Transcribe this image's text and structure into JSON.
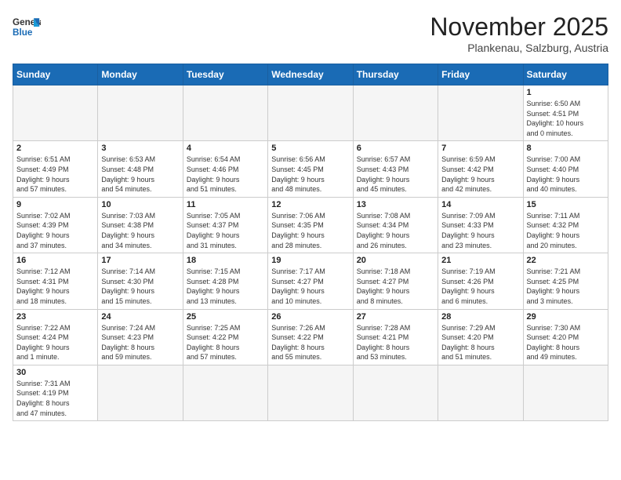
{
  "header": {
    "logo_line1": "General",
    "logo_line2": "Blue",
    "month": "November 2025",
    "location": "Plankenau, Salzburg, Austria"
  },
  "days_of_week": [
    "Sunday",
    "Monday",
    "Tuesday",
    "Wednesday",
    "Thursday",
    "Friday",
    "Saturday"
  ],
  "weeks": [
    [
      {
        "day": "",
        "info": ""
      },
      {
        "day": "",
        "info": ""
      },
      {
        "day": "",
        "info": ""
      },
      {
        "day": "",
        "info": ""
      },
      {
        "day": "",
        "info": ""
      },
      {
        "day": "",
        "info": ""
      },
      {
        "day": "1",
        "info": "Sunrise: 6:50 AM\nSunset: 4:51 PM\nDaylight: 10 hours\nand 0 minutes."
      }
    ],
    [
      {
        "day": "2",
        "info": "Sunrise: 6:51 AM\nSunset: 4:49 PM\nDaylight: 9 hours\nand 57 minutes."
      },
      {
        "day": "3",
        "info": "Sunrise: 6:53 AM\nSunset: 4:48 PM\nDaylight: 9 hours\nand 54 minutes."
      },
      {
        "day": "4",
        "info": "Sunrise: 6:54 AM\nSunset: 4:46 PM\nDaylight: 9 hours\nand 51 minutes."
      },
      {
        "day": "5",
        "info": "Sunrise: 6:56 AM\nSunset: 4:45 PM\nDaylight: 9 hours\nand 48 minutes."
      },
      {
        "day": "6",
        "info": "Sunrise: 6:57 AM\nSunset: 4:43 PM\nDaylight: 9 hours\nand 45 minutes."
      },
      {
        "day": "7",
        "info": "Sunrise: 6:59 AM\nSunset: 4:42 PM\nDaylight: 9 hours\nand 42 minutes."
      },
      {
        "day": "8",
        "info": "Sunrise: 7:00 AM\nSunset: 4:40 PM\nDaylight: 9 hours\nand 40 minutes."
      }
    ],
    [
      {
        "day": "9",
        "info": "Sunrise: 7:02 AM\nSunset: 4:39 PM\nDaylight: 9 hours\nand 37 minutes."
      },
      {
        "day": "10",
        "info": "Sunrise: 7:03 AM\nSunset: 4:38 PM\nDaylight: 9 hours\nand 34 minutes."
      },
      {
        "day": "11",
        "info": "Sunrise: 7:05 AM\nSunset: 4:37 PM\nDaylight: 9 hours\nand 31 minutes."
      },
      {
        "day": "12",
        "info": "Sunrise: 7:06 AM\nSunset: 4:35 PM\nDaylight: 9 hours\nand 28 minutes."
      },
      {
        "day": "13",
        "info": "Sunrise: 7:08 AM\nSunset: 4:34 PM\nDaylight: 9 hours\nand 26 minutes."
      },
      {
        "day": "14",
        "info": "Sunrise: 7:09 AM\nSunset: 4:33 PM\nDaylight: 9 hours\nand 23 minutes."
      },
      {
        "day": "15",
        "info": "Sunrise: 7:11 AM\nSunset: 4:32 PM\nDaylight: 9 hours\nand 20 minutes."
      }
    ],
    [
      {
        "day": "16",
        "info": "Sunrise: 7:12 AM\nSunset: 4:31 PM\nDaylight: 9 hours\nand 18 minutes."
      },
      {
        "day": "17",
        "info": "Sunrise: 7:14 AM\nSunset: 4:30 PM\nDaylight: 9 hours\nand 15 minutes."
      },
      {
        "day": "18",
        "info": "Sunrise: 7:15 AM\nSunset: 4:28 PM\nDaylight: 9 hours\nand 13 minutes."
      },
      {
        "day": "19",
        "info": "Sunrise: 7:17 AM\nSunset: 4:27 PM\nDaylight: 9 hours\nand 10 minutes."
      },
      {
        "day": "20",
        "info": "Sunrise: 7:18 AM\nSunset: 4:27 PM\nDaylight: 9 hours\nand 8 minutes."
      },
      {
        "day": "21",
        "info": "Sunrise: 7:19 AM\nSunset: 4:26 PM\nDaylight: 9 hours\nand 6 minutes."
      },
      {
        "day": "22",
        "info": "Sunrise: 7:21 AM\nSunset: 4:25 PM\nDaylight: 9 hours\nand 3 minutes."
      }
    ],
    [
      {
        "day": "23",
        "info": "Sunrise: 7:22 AM\nSunset: 4:24 PM\nDaylight: 9 hours\nand 1 minute."
      },
      {
        "day": "24",
        "info": "Sunrise: 7:24 AM\nSunset: 4:23 PM\nDaylight: 8 hours\nand 59 minutes."
      },
      {
        "day": "25",
        "info": "Sunrise: 7:25 AM\nSunset: 4:22 PM\nDaylight: 8 hours\nand 57 minutes."
      },
      {
        "day": "26",
        "info": "Sunrise: 7:26 AM\nSunset: 4:22 PM\nDaylight: 8 hours\nand 55 minutes."
      },
      {
        "day": "27",
        "info": "Sunrise: 7:28 AM\nSunset: 4:21 PM\nDaylight: 8 hours\nand 53 minutes."
      },
      {
        "day": "28",
        "info": "Sunrise: 7:29 AM\nSunset: 4:20 PM\nDaylight: 8 hours\nand 51 minutes."
      },
      {
        "day": "29",
        "info": "Sunrise: 7:30 AM\nSunset: 4:20 PM\nDaylight: 8 hours\nand 49 minutes."
      }
    ],
    [
      {
        "day": "30",
        "info": "Sunrise: 7:31 AM\nSunset: 4:19 PM\nDaylight: 8 hours\nand 47 minutes."
      },
      {
        "day": "",
        "info": ""
      },
      {
        "day": "",
        "info": ""
      },
      {
        "day": "",
        "info": ""
      },
      {
        "day": "",
        "info": ""
      },
      {
        "day": "",
        "info": ""
      },
      {
        "day": "",
        "info": ""
      }
    ]
  ]
}
